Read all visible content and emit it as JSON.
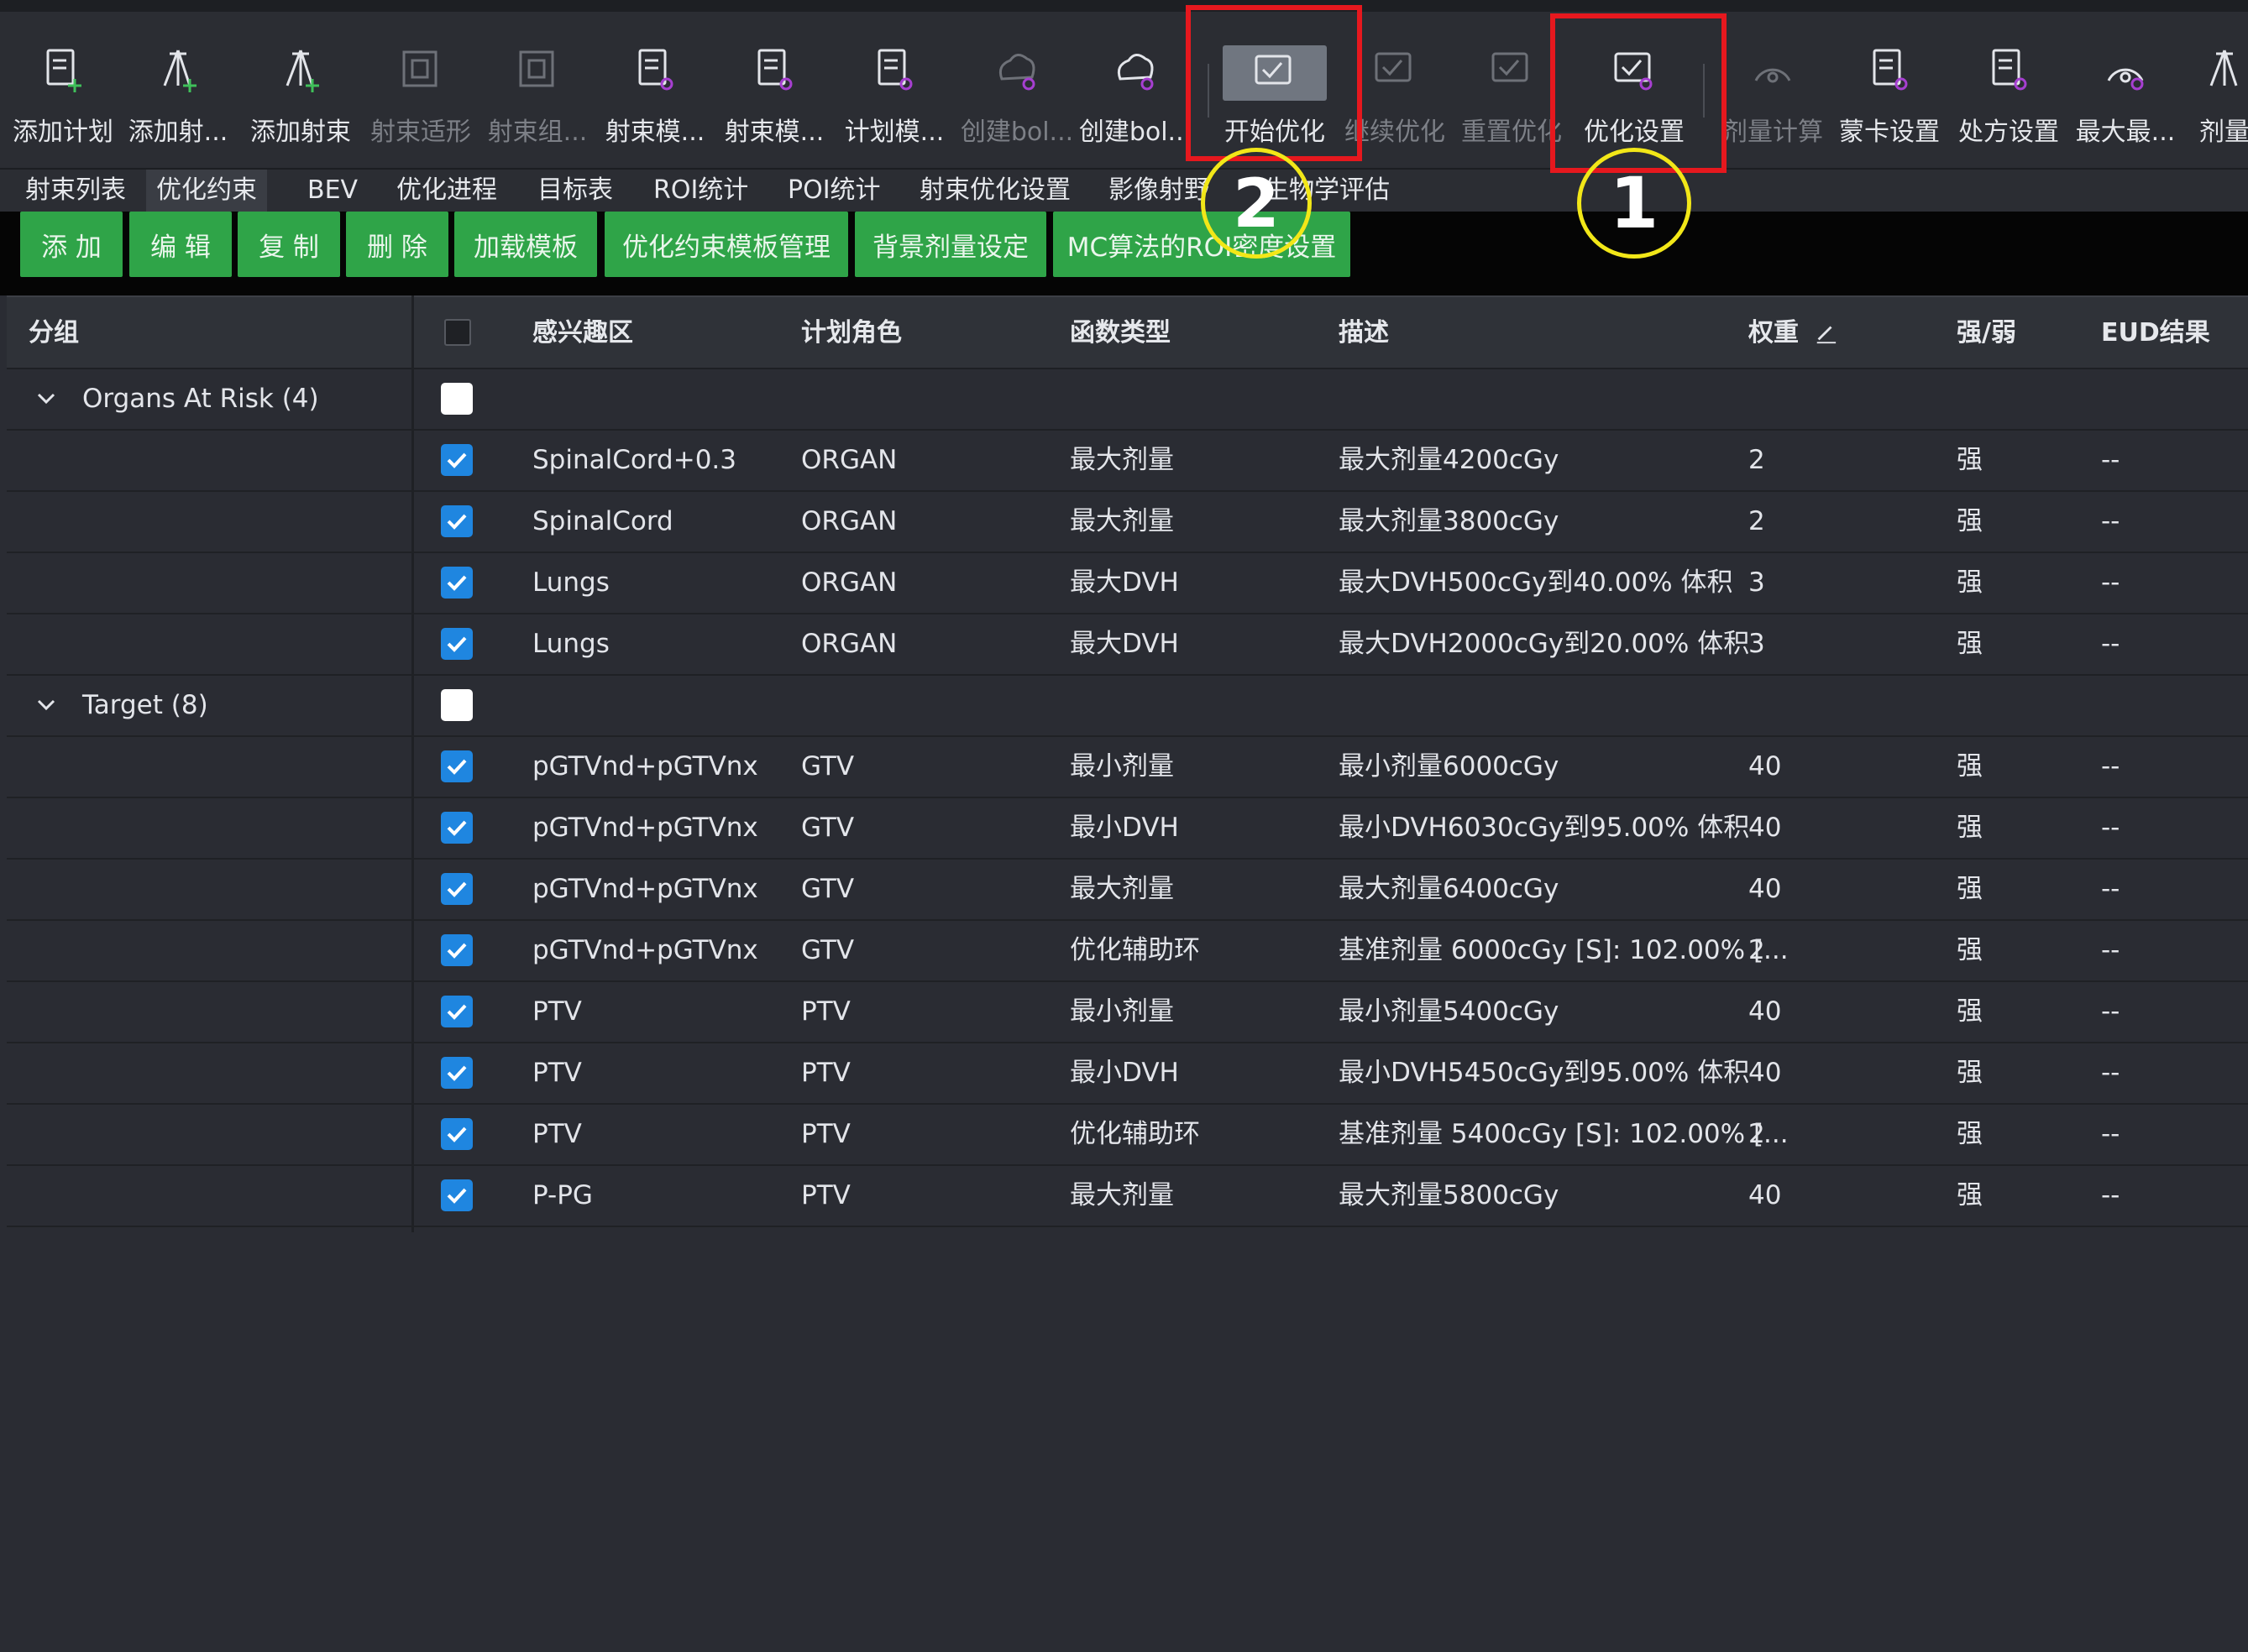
{
  "toolbar": {
    "items": [
      {
        "label": "添加计划",
        "icon": "add-plan-icon",
        "state": "enabled"
      },
      {
        "label": "添加射...",
        "icon": "add-beam-fan-icon",
        "state": "enabled"
      },
      {
        "label": "添加射束",
        "icon": "add-beam-icon",
        "state": "enabled"
      },
      {
        "label": "射束适形",
        "icon": "beam-conform-icon",
        "state": "disabled"
      },
      {
        "label": "射束组...",
        "icon": "beam-group-icon",
        "state": "disabled"
      },
      {
        "label": "射束模...",
        "icon": "beam-template-icon",
        "state": "enabled"
      },
      {
        "label": "射束模...",
        "icon": "beam-template-edit-icon",
        "state": "enabled"
      },
      {
        "label": "计划模...",
        "icon": "plan-template-icon",
        "state": "enabled"
      },
      {
        "label": "创建bol...",
        "icon": "create-bolus-icon",
        "state": "disabled"
      },
      {
        "label": "创建bol...",
        "icon": "create-bolus-2-icon",
        "state": "enabled"
      },
      {
        "label": "开始优化",
        "icon": "start-optimize-icon",
        "state": "active"
      },
      {
        "label": "继续优化",
        "icon": "continue-optimize-icon",
        "state": "disabled"
      },
      {
        "label": "重置优化",
        "icon": "reset-optimize-icon",
        "state": "disabled"
      },
      {
        "label": "优化设置",
        "icon": "optimize-settings-icon",
        "state": "enabled"
      },
      {
        "label": "剂量计算",
        "icon": "dose-calc-icon",
        "state": "disabled"
      },
      {
        "label": "蒙卡设置",
        "icon": "monte-carlo-settings-icon",
        "state": "enabled"
      },
      {
        "label": "处方设置",
        "icon": "prescription-settings-icon",
        "state": "enabled"
      },
      {
        "label": "最大最...",
        "icon": "max-min-icon",
        "state": "enabled"
      },
      {
        "label": "剂量",
        "icon": "dose-icon",
        "state": "enabled"
      }
    ]
  },
  "tabs": [
    "射束列表",
    "优化约束",
    "BEV",
    "优化进程",
    "目标表",
    "ROI统计",
    "POI统计",
    "射束优化设置",
    "影像射野",
    "生物学评估"
  ],
  "active_tab": "优化约束",
  "buttons": [
    "添 加",
    "编 辑",
    "复 制",
    "删 除",
    "加载模板",
    "优化约束模板管理",
    "背景剂量设定",
    "MC算法的ROI密度设置"
  ],
  "table": {
    "headers": [
      "分组",
      "感兴趣区",
      "计划角色",
      "函数类型",
      "描述",
      "权重",
      "强/弱",
      "EUD结果"
    ],
    "groups": [
      {
        "name": "Organs At Risk (4)",
        "rows": [
          {
            "roi": "SpinalCord+0.3",
            "role": "ORGAN",
            "func": "最大剂量",
            "desc": "最大剂量4200cGy",
            "weight": "2",
            "strength": "强",
            "eud": "--"
          },
          {
            "roi": "SpinalCord",
            "role": "ORGAN",
            "func": "最大剂量",
            "desc": "最大剂量3800cGy",
            "weight": "2",
            "strength": "强",
            "eud": "--"
          },
          {
            "roi": "Lungs",
            "role": "ORGAN",
            "func": "最大DVH",
            "desc": "最大DVH500cGy到40.00% 体积",
            "weight": "3",
            "strength": "强",
            "eud": "--"
          },
          {
            "roi": "Lungs",
            "role": "ORGAN",
            "func": "最大DVH",
            "desc": "最大DVH2000cGy到20.00% 体积",
            "weight": "3",
            "strength": "强",
            "eud": "--"
          }
        ]
      },
      {
        "name": "Target (8)",
        "rows": [
          {
            "roi": "pGTVnd+pGTVnx",
            "role": "GTV",
            "func": "最小剂量",
            "desc": "最小剂量6000cGy",
            "weight": "40",
            "strength": "强",
            "eud": "--"
          },
          {
            "roi": "pGTVnd+pGTVnx",
            "role": "GTV",
            "func": "最小DVH",
            "desc": "最小DVH6030cGy到95.00% 体积",
            "weight": "40",
            "strength": "强",
            "eud": "--"
          },
          {
            "roi": "pGTVnd+pGTVnx",
            "role": "GTV",
            "func": "最大剂量",
            "desc": "最大剂量6400cGy",
            "weight": "40",
            "strength": "强",
            "eud": "--"
          },
          {
            "roi": "pGTVnd+pGTVnx",
            "role": "GTV",
            "func": "优化辅助环",
            "desc": "基准剂量 6000cGy [S]: 102.00% [...",
            "weight": "2",
            "strength": "强",
            "eud": "--"
          },
          {
            "roi": "PTV",
            "role": "PTV",
            "func": "最小剂量",
            "desc": "最小剂量5400cGy",
            "weight": "40",
            "strength": "强",
            "eud": "--"
          },
          {
            "roi": "PTV",
            "role": "PTV",
            "func": "最小DVH",
            "desc": "最小DVH5450cGy到95.00% 体积",
            "weight": "40",
            "strength": "强",
            "eud": "--"
          },
          {
            "roi": "PTV",
            "role": "PTV",
            "func": "优化辅助环",
            "desc": "基准剂量 5400cGy [S]: 102.00% [...",
            "weight": "2",
            "strength": "强",
            "eud": "--"
          },
          {
            "roi": "P-PG",
            "role": "PTV",
            "func": "最大剂量",
            "desc": "最大剂量5800cGy",
            "weight": "40",
            "strength": "强",
            "eud": "--"
          }
        ]
      }
    ]
  },
  "annotations": {
    "circle_1": "1",
    "circle_2": "2"
  },
  "colors": {
    "accent_green": "#2fa448",
    "checkbox_blue": "#1f86e0",
    "highlight_red": "#e6181e",
    "circle_yellow": "#f2e718"
  }
}
